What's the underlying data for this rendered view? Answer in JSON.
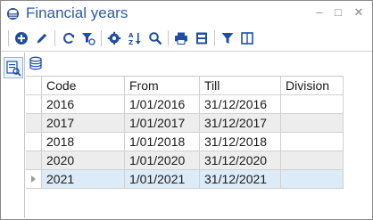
{
  "window": {
    "title": "Financial years",
    "controls": {
      "minimize": "–",
      "maximize": "□",
      "close": "✕"
    }
  },
  "toolbar": {
    "buttons": [
      {
        "icon": "add-icon"
      },
      {
        "icon": "edit-icon"
      },
      {
        "icon": "refresh-icon"
      },
      {
        "icon": "filter-clear-icon"
      },
      {
        "icon": "settings-icon"
      },
      {
        "icon": "sort-az-icon"
      },
      {
        "icon": "search-icon"
      },
      {
        "icon": "print-icon"
      },
      {
        "icon": "print-preview-icon"
      },
      {
        "icon": "filter-icon"
      },
      {
        "icon": "columns-icon"
      }
    ]
  },
  "colors": {
    "title": "#2e5aa6",
    "accent": "#1f5fb8",
    "selected_row": "#dcebf8",
    "alt_row": "#ededed"
  },
  "grid": {
    "columns": [
      "Code",
      "From",
      "Till",
      "Division"
    ],
    "rows": [
      {
        "code": "2016",
        "from": "1/01/2016",
        "till": "31/12/2016",
        "division": ""
      },
      {
        "code": "2017",
        "from": "1/01/2017",
        "till": "31/12/2017",
        "division": ""
      },
      {
        "code": "2018",
        "from": "1/01/2018",
        "till": "31/12/2018",
        "division": ""
      },
      {
        "code": "2020",
        "from": "1/01/2020",
        "till": "31/12/2020",
        "division": ""
      },
      {
        "code": "2021",
        "from": "1/01/2021",
        "till": "31/12/2021",
        "division": ""
      }
    ],
    "selected_row": 4
  }
}
